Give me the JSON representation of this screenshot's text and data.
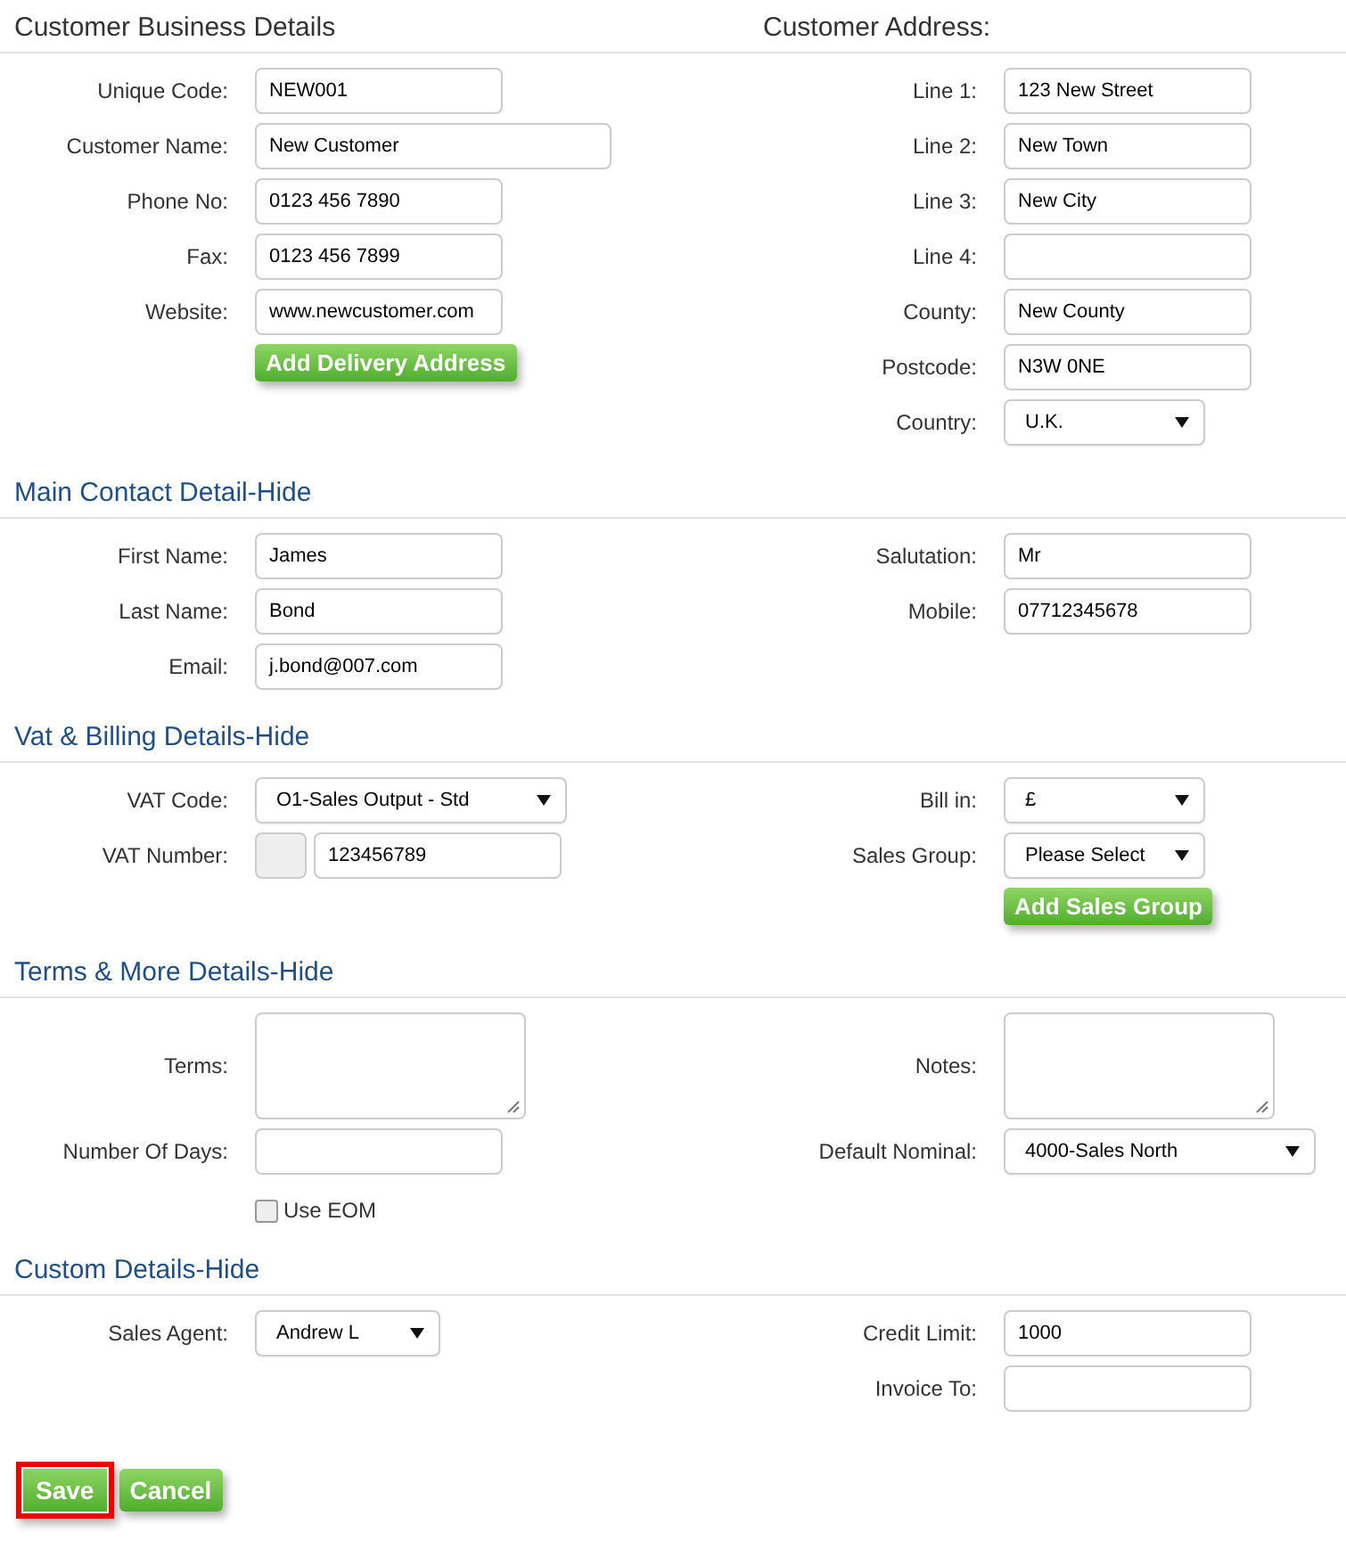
{
  "sections": [
    {
      "title": "Customer Business Details",
      "kind": "plain",
      "right_title": "Customer Address:",
      "left": [
        {
          "kind": "input",
          "label": "Unique Code:",
          "value": "NEW001"
        },
        {
          "kind": "input-wide",
          "label": "Customer Name:",
          "value": "New Customer"
        },
        {
          "kind": "input",
          "label": "Phone No:",
          "value": "0123 456 7890"
        },
        {
          "kind": "input",
          "label": "Fax:",
          "value": "0123 456 7899"
        },
        {
          "kind": "input",
          "label": "Website:",
          "value": "www.newcustomer.com"
        },
        {
          "kind": "button",
          "text": "Add Delivery Address"
        }
      ],
      "right": [
        {
          "kind": "input",
          "label": "Line 1:",
          "value": "123 New Street"
        },
        {
          "kind": "input",
          "label": "Line 2:",
          "value": "New Town"
        },
        {
          "kind": "input",
          "label": "Line 3:",
          "value": "New City"
        },
        {
          "kind": "input",
          "label": "Line 4:"
        },
        {
          "kind": "input",
          "label": "County:",
          "value": "New County"
        },
        {
          "kind": "input",
          "label": "Postcode:",
          "value": "N3W 0NE"
        },
        {
          "kind": "select",
          "label": "Country:",
          "value": "U.K."
        }
      ]
    },
    {
      "title": "Main Contact Detail-Hide",
      "kind": "link",
      "left": [
        {
          "kind": "input",
          "label": "First Name:",
          "value": "James"
        },
        {
          "kind": "input",
          "label": "Last Name:",
          "value": "Bond"
        },
        {
          "kind": "input",
          "label": "Email:",
          "value": "j.bond@007.com"
        }
      ],
      "right": [
        {
          "kind": "input",
          "label": "Salutation:",
          "value": "Mr"
        },
        {
          "kind": "input",
          "label": "Mobile:",
          "value": "07712345678"
        }
      ]
    },
    {
      "title": "Vat & Billing Details-Hide",
      "kind": "link",
      "left": [
        {
          "kind": "select-wide",
          "label": "VAT Code:",
          "value": "O1-Sales Output - Std"
        },
        {
          "kind": "prefixed",
          "label": "VAT Number:",
          "value": "123456789"
        }
      ],
      "right": [
        {
          "kind": "select",
          "label": "Bill in:",
          "value": "£"
        },
        {
          "kind": "select",
          "label": "Sales Group:",
          "value": "Please Select"
        },
        {
          "kind": "button",
          "text": "Add Sales Group"
        }
      ]
    },
    {
      "title": "Terms & More Details-Hide",
      "kind": "link",
      "left": [
        {
          "kind": "textarea",
          "label": "Terms:"
        },
        {
          "kind": "input",
          "label": "Number Of Days:"
        },
        {
          "kind": "checkbox",
          "text": "Use EOM",
          "checked": false
        }
      ],
      "right": [
        {
          "kind": "textarea",
          "label": "Notes:"
        },
        {
          "kind": "select-wide",
          "label": "Default Nominal:",
          "value": "4000-Sales North"
        }
      ]
    },
    {
      "title": "Custom Details-Hide",
      "kind": "link",
      "left": [
        {
          "kind": "select-narrow",
          "label": "Sales Agent:",
          "value": "Andrew L"
        }
      ],
      "right": [
        {
          "kind": "input",
          "label": "Credit Limit:",
          "value": "1000"
        },
        {
          "kind": "input",
          "label": "Invoice To:"
        }
      ]
    }
  ],
  "actions": [
    {
      "text": "Save",
      "highlighted": true
    },
    {
      "text": "Cancel",
      "highlighted": false
    }
  ]
}
